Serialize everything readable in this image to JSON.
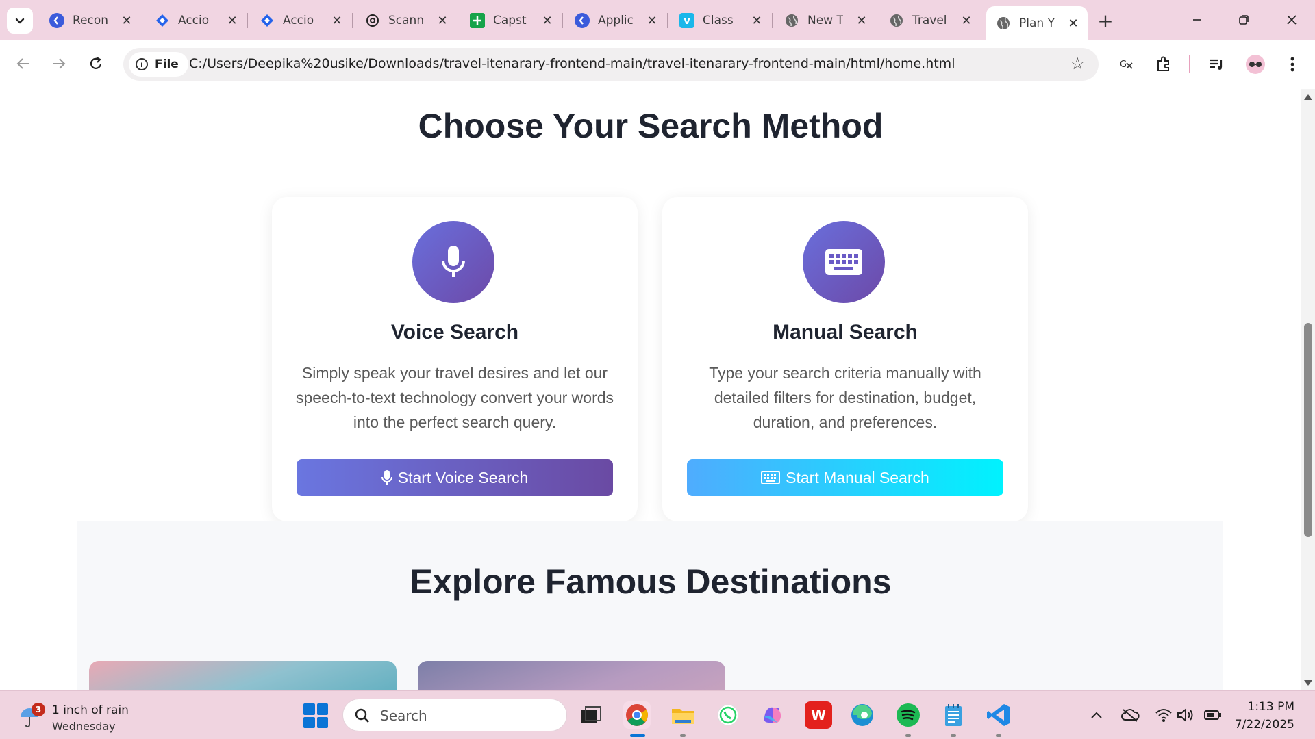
{
  "browser": {
    "tabs": [
      {
        "label": "Recon",
        "icon": "kinde-icon",
        "color": "#3b5bdb"
      },
      {
        "label": "Accio",
        "icon": "jira-icon",
        "color": "#2563eb"
      },
      {
        "label": "Accio",
        "icon": "jira-icon",
        "color": "#2563eb"
      },
      {
        "label": "Scann",
        "icon": "chatgpt-icon",
        "color": "#222222"
      },
      {
        "label": "Capst",
        "icon": "sheets-icon",
        "color": "#16a34a"
      },
      {
        "label": "Applic",
        "icon": "kinde-icon",
        "color": "#3b5bdb"
      },
      {
        "label": "Class",
        "icon": "vimeo-icon",
        "color": "#1ab7ea"
      },
      {
        "label": "New T",
        "icon": "globe-icon",
        "color": "#555555"
      },
      {
        "label": "Travel",
        "icon": "globe-icon",
        "color": "#555555"
      },
      {
        "label": "Plan Y",
        "icon": "globe-icon",
        "color": "#555555",
        "active": true
      }
    ],
    "address": {
      "scheme_label": "File",
      "url": "C:/Users/Deepika%20usike/Downloads/travel-itenarary-frontend-main/travel-itenarary-frontend-main/html/home.html"
    }
  },
  "page": {
    "search_section": {
      "title": "Choose Your Search Method",
      "cards": [
        {
          "title": "Voice Search",
          "description": "Simply speak your travel desires and let our speech-to-text technology convert your words into the perfect search query.",
          "button": "Start Voice Search",
          "icon": "microphone-icon"
        },
        {
          "title": "Manual Search",
          "description": "Type your search criteria manually with detailed filters for destination, budget, duration, and preferences.",
          "button": "Start Manual Search",
          "icon": "keyboard-icon"
        }
      ]
    },
    "explore_section": {
      "title": "Explore Famous Destinations"
    }
  },
  "taskbar": {
    "weather": {
      "badge": "3",
      "line1": "1 inch of rain",
      "line2": "Wednesday"
    },
    "search_placeholder": "Search",
    "clock": {
      "time": "1:13 PM",
      "date": "7/22/2025"
    }
  }
}
